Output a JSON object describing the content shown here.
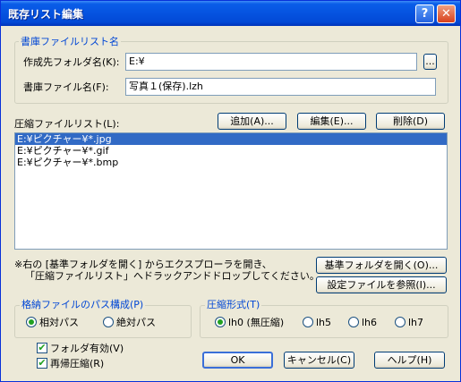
{
  "window": {
    "title": "既存リスト編集",
    "help_glyph": "?",
    "close_glyph": "✕"
  },
  "library_group": {
    "label": "書庫ファイルリスト名",
    "dest_folder_label": "作成先フォルダ名(K):",
    "dest_folder_value": "E:¥",
    "browse_label": "...",
    "archive_name_label": "書庫ファイル名(F):",
    "archive_name_value": "写真１(保存).lzh"
  },
  "compress_list": {
    "label": "圧縮ファイルリスト(L):",
    "add_label": "追加(A)...",
    "edit_label": "編集(E)...",
    "delete_label": "削除(D)",
    "items": [
      "E:¥ピクチャー¥*.jpg",
      "E:¥ピクチャー¥*.gif",
      "E:¥ピクチャー¥*.bmp"
    ],
    "selected_index": 0
  },
  "note": {
    "line1": "※右の [基準フォルダを開く] からエクスプローラを開き、",
    "line2": "「圧縮ファイルリスト」へドラックアンドドロップしてください。"
  },
  "open_base_folder_label": "基準フォルダを開く(O)...",
  "view_settings_label": "設定ファイルを参照(I)...",
  "path_group": {
    "label": "格納ファイルのパス構成(P)",
    "relative_label": "相対パス",
    "absolute_label": "絶対パス",
    "selected": "relative"
  },
  "format_group": {
    "label": "圧縮形式(T)",
    "options": [
      "lh0 (無圧縮)",
      "lh5",
      "lh6",
      "lh7"
    ],
    "selected": "lh0 (無圧縮)"
  },
  "folder_enabled_label": "フォルダ有効(V)",
  "folder_enabled_checked": true,
  "recursive_label": "再帰圧縮(R)",
  "recursive_checked": true,
  "ok_label": "OK",
  "cancel_label": "キャンセル(C)",
  "help_label": "ヘルプ(H)",
  "check_glyph": "✔"
}
